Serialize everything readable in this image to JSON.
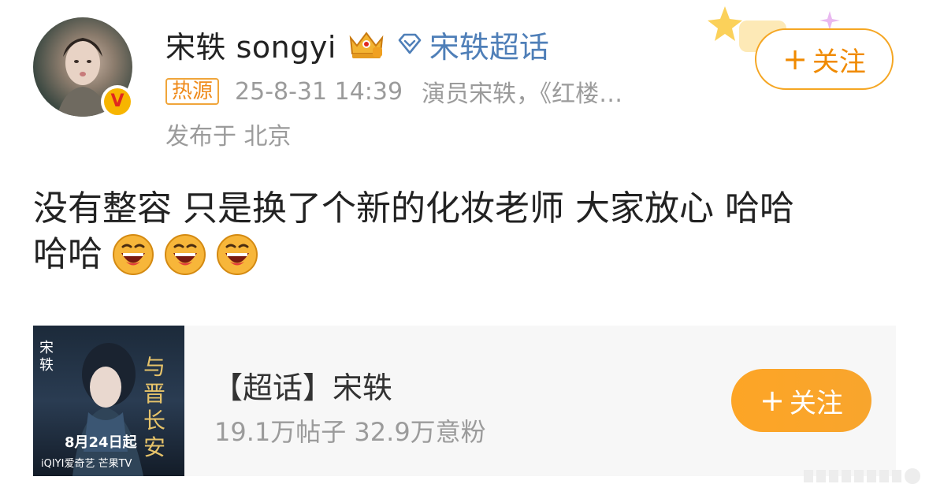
{
  "user": {
    "name": "宋轶 songyi",
    "supertopic_link": "宋轶超话"
  },
  "meta": {
    "hot_badge": "热源",
    "time": "25-8-31 14:39",
    "bio": "演员宋轶，《红楼…",
    "location": "发布于 北京"
  },
  "follow_top": {
    "plus": "+",
    "label": "关注"
  },
  "post": {
    "line1": "没有整容 只是换了个新的化妆老师 大家放心 哈哈",
    "line2": "哈哈",
    "emojis": [
      "laughing-emoji",
      "laughing-emoji",
      "laughing-emoji"
    ]
  },
  "card": {
    "title": "【超话】宋轶",
    "stats": "19.1万帖子 32.9万意粉",
    "poster": {
      "name": "宋轶",
      "date": "8月24日起",
      "drama_title": "与晋长安",
      "platforms": "iQIYI爱奇艺 芒果TV"
    },
    "follow_plus": "+",
    "follow_label": "关注"
  },
  "colors": {
    "accent_orange": "#f5a623",
    "link_blue": "#4f7fb8",
    "muted_gray": "#9b9b9b"
  }
}
